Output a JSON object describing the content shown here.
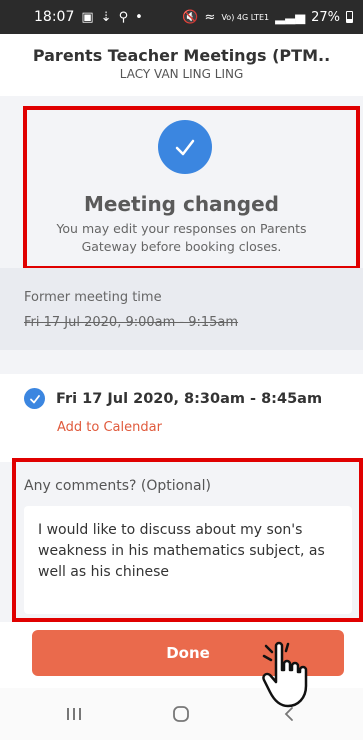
{
  "status_bar": {
    "time": "18:07",
    "signal_text": "Vo) 4G LTE1",
    "battery": "27%"
  },
  "header": {
    "title": "Parents Teacher Meetings (PTM..",
    "subtitle": "LACY VAN LING LING"
  },
  "confirmation": {
    "title": "Meeting changed",
    "message": "You may edit your responses on Parents Gateway before booking closes."
  },
  "former": {
    "label": "Former meeting time",
    "time": "Fri 17 Jul 2020, 9:00am - 9:15am"
  },
  "new_meeting": {
    "time": "Fri 17 Jul 2020, 8:30am - 8:45am",
    "add_calendar": "Add to Calendar"
  },
  "comments": {
    "label": "Any comments? (Optional)",
    "value": "I would like to discuss about my son's weakness in his mathematics subject, as well as his chinese"
  },
  "done_button": "Done",
  "colors": {
    "accent_blue": "#3b86e0",
    "button_orange": "#ea6a4c",
    "link_orange": "#e05a3c",
    "highlight_red": "#e00000"
  }
}
